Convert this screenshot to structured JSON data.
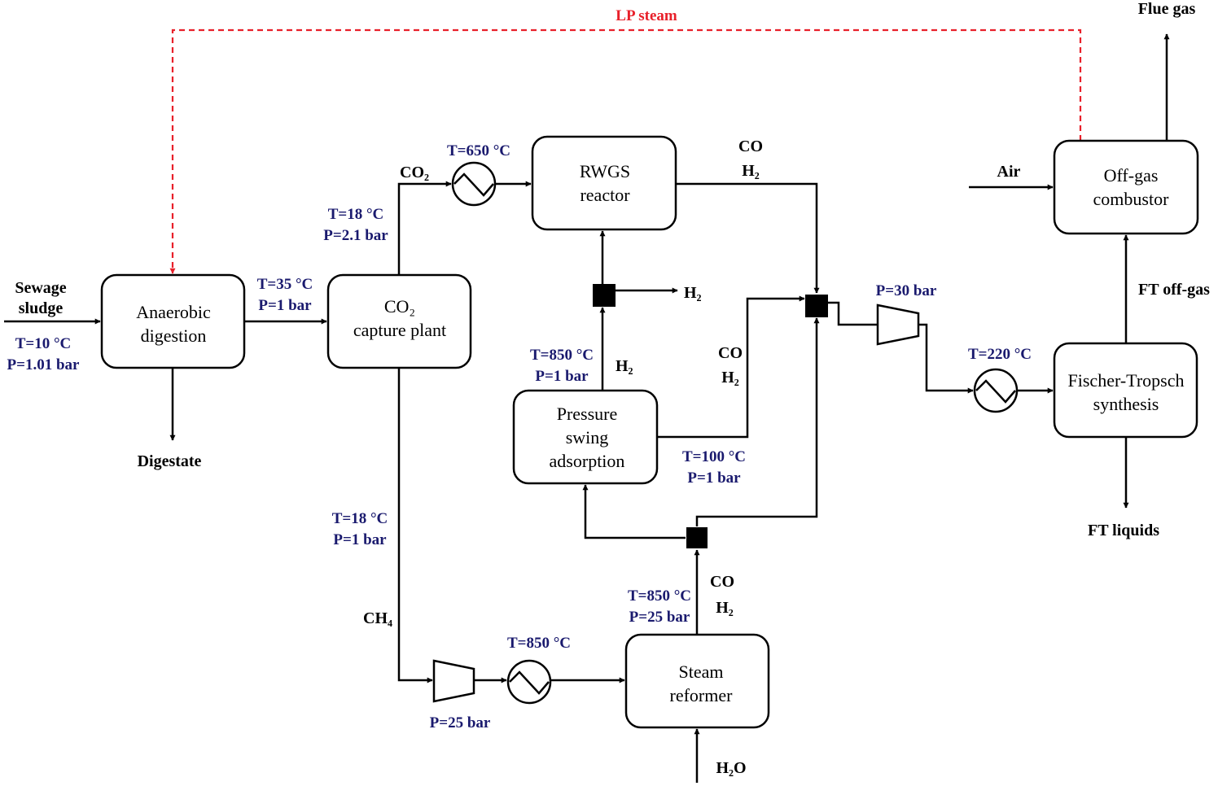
{
  "colors": {
    "line": "#000000",
    "conditions": "#1a1a6e",
    "lp_steam": "#e8202a"
  },
  "units": {
    "anaerobic": [
      "Anaerobic",
      "digestion"
    ],
    "co2_capture": [
      "CO₂",
      "capture plant"
    ],
    "rwgs": [
      "RWGS",
      "reactor"
    ],
    "psa": [
      "Pressure",
      "swing",
      "adsorption"
    ],
    "steam_reformer": [
      "Steam",
      "reformer"
    ],
    "offgas": [
      "Off-gas",
      "combustor"
    ],
    "ft": [
      "Fischer-Tropsch",
      "synthesis"
    ]
  },
  "streams": {
    "sewage": [
      "Sewage",
      "sludge"
    ],
    "digestate": "Digestate",
    "lp_steam": "LP steam",
    "co2": "CO₂",
    "ch4": "CH₄",
    "co": "CO",
    "h2": "H₂",
    "h2o": "H₂O",
    "air": "Air",
    "flue_gas": "Flue gas",
    "ft_offgas": "FT off-gas",
    "ft_liquids": "FT liquids"
  },
  "conditions": {
    "sewage": [
      "T=10 °C",
      "P=1.01 bar"
    ],
    "ad_out": [
      "T=35 °C",
      "P=1 bar"
    ],
    "co2_out": [
      "T=18 °C",
      "P=2.1 bar"
    ],
    "ch4_out": [
      "T=18 °C",
      "P=1 bar"
    ],
    "rwgs_in": "T=650 °C",
    "psa_h2": [
      "T=850 °C",
      "P=1 bar"
    ],
    "psa_out": [
      "T=100 °C",
      "P=1 bar"
    ],
    "sr_out": [
      "T=850 °C",
      "P=25 bar"
    ],
    "sr_in": "T=850 °C",
    "comp1": "P=25 bar",
    "comp2": "P=30 bar",
    "ft_in": "T=220 °C"
  }
}
